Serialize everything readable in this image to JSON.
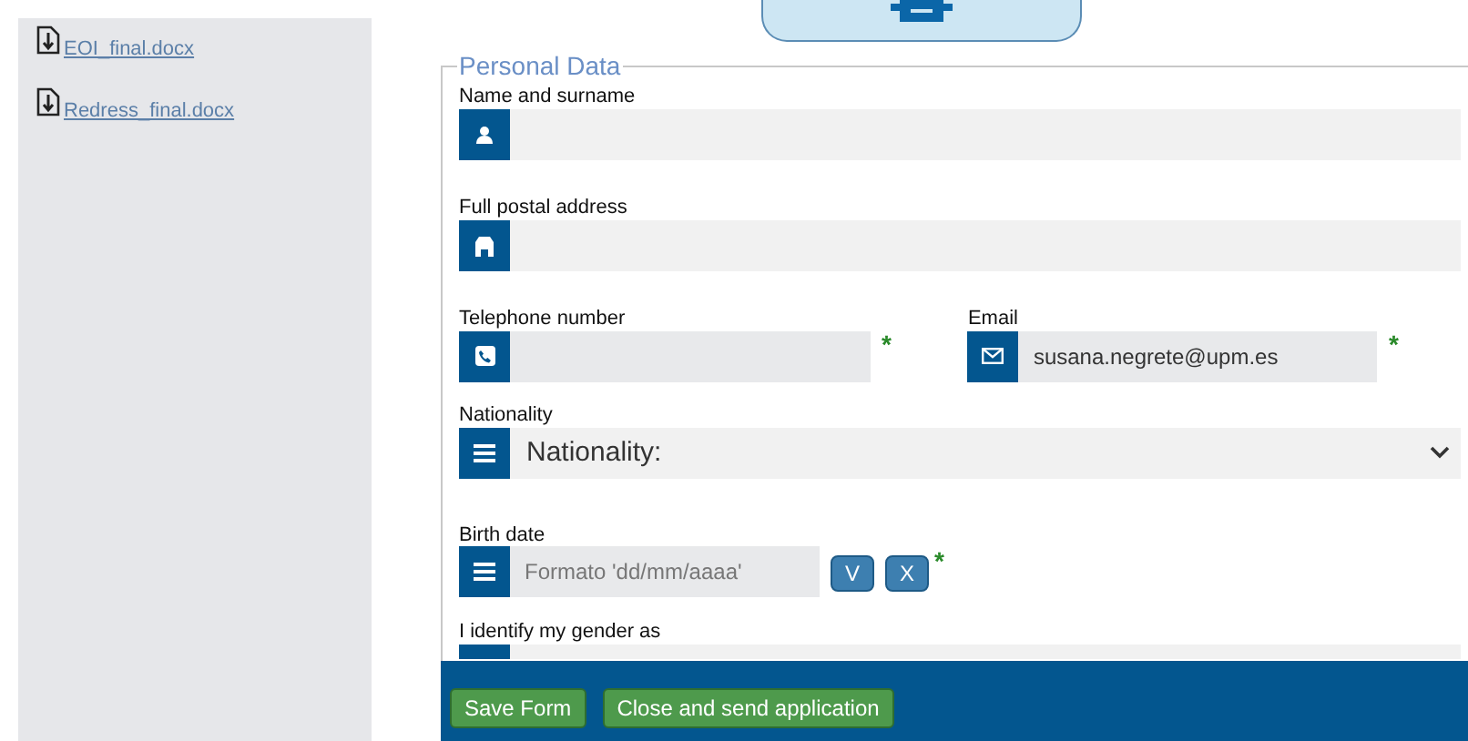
{
  "sidebar": {
    "files": [
      {
        "name": "EOI_final.docx"
      },
      {
        "name": "Redress_final.docx"
      }
    ]
  },
  "form": {
    "legend": "Personal Data",
    "fields": [
      {
        "kind": "text",
        "label": "Name and surname"
      },
      {
        "kind": "text",
        "label": "Full postal address"
      },
      {
        "kind": "pair",
        "items": [
          {
            "label": "Telephone number",
            "asterisk": "*"
          },
          {
            "label": "Email",
            "value": "susana.negrete@upm.es",
            "asterisk": "*"
          }
        ]
      },
      {
        "kind": "select",
        "label": "Nationality",
        "placeholder": "Nationality:"
      },
      {
        "kind": "date",
        "label": "Birth date",
        "placeholder": "Formato 'dd/mm/aaaa'",
        "buttons": [
          "V",
          "X"
        ],
        "asterisk": "*"
      },
      {
        "kind": "select",
        "label": "I identify my gender as"
      }
    ]
  },
  "footer": {
    "buttons": [
      "Save Form",
      "Close and send application"
    ]
  }
}
